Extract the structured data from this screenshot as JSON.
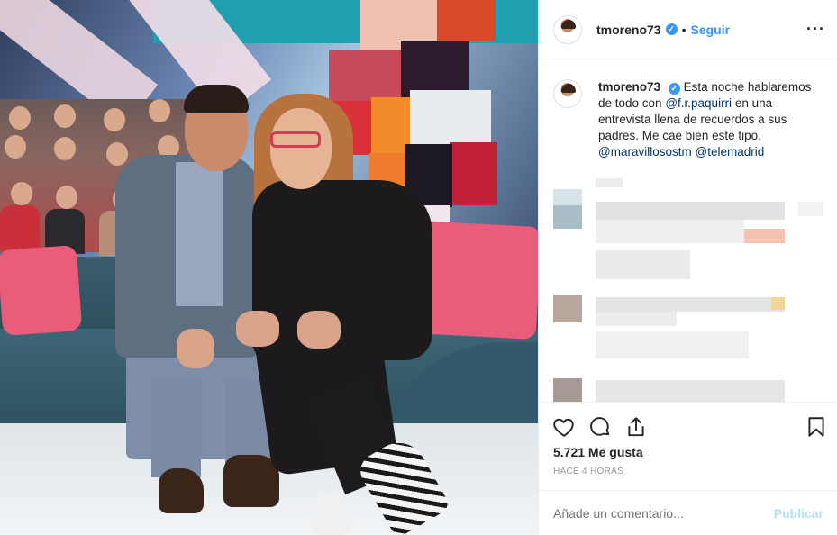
{
  "post": {
    "username": "tmoreno73",
    "verified_mark": "✓",
    "separator": "•",
    "follow_label": "Seguir",
    "more_label": "···"
  },
  "caption": {
    "username": "tmoreno73",
    "verified_mark": "✓",
    "text_part1": "Esta noche hablaremos de todo con",
    "mention1": "@f.r.paquirri",
    "text_part2": "en una entrevista llena de recuerdos a sus padres. Me cae bien este tipo.",
    "mention2": "@maravillosostm",
    "mention3": "@telemadrid"
  },
  "actions": {
    "likes": "5.721 Me gusta",
    "timestamp": "HACE 4 HORAS",
    "icons": [
      "heart-icon",
      "comment-icon",
      "share-icon",
      "bookmark-icon"
    ]
  },
  "comment_box": {
    "placeholder": "Añade un comentario...",
    "publish_label": "Publicar"
  },
  "colors": {
    "accent": "#3897f0",
    "mention": "#003569",
    "publish_disabled": "#b2dffc",
    "muted": "#999999"
  }
}
